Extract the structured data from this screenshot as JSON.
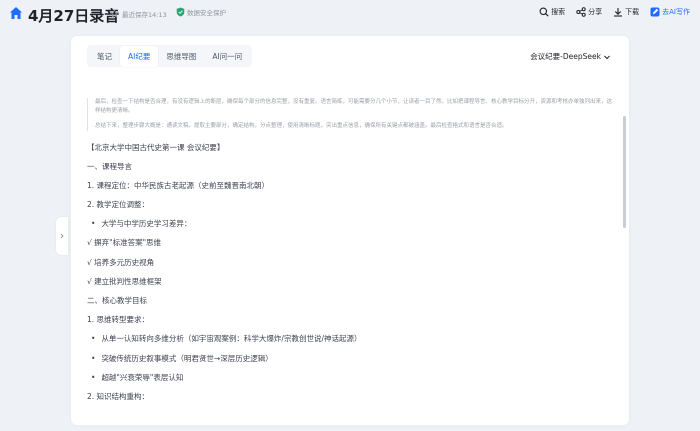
{
  "header": {
    "title": "4月27日录音",
    "saved_text": "最近保存14:13",
    "protect_text": "数据安全保护",
    "actions": {
      "search": "搜索",
      "share": "分享",
      "download": "下载",
      "ai_write": "去AI写作"
    }
  },
  "tabs": [
    "笔记",
    "AI纪要",
    "思维导图",
    "AI问一问"
  ],
  "model_select": "会议纪要-DeepSeek",
  "thinking": [
    "最后，检查一下结构是否合理，有没有逻辑上的断层，确保每个部分的信息完整，没有重复。语言简练，可能需要分几个小节，让读者一目了然。比如把课程导言、核心教学目标分开，资源和考核办单独列出来，这样结构更清晰。",
    "总结下来，整理步骤大概是：通读文稿，提取主要部分，确定结构，分点整理，使用清晰标题，突出重点信息，确保所有关键点都被涵盖。最后检查格式和语言是否合适。"
  ],
  "lines": [
    {
      "text": "【北京大学中国古代史第一课 会议纪要】",
      "type": "plain"
    },
    {
      "text": "一、课程导言",
      "type": "plain"
    },
    {
      "text": "1. 课程定位：中华民族古老起源（史前至魏晋南北朝）",
      "type": "plain"
    },
    {
      "text": "2. 教学定位调整：",
      "type": "plain"
    },
    {
      "text": "大学与中学历史学习差异：",
      "type": "bullet"
    },
    {
      "text": "√ 摒弃\"标准答案\"思维",
      "type": "plain"
    },
    {
      "text": "√ 培养多元历史视角",
      "type": "plain"
    },
    {
      "text": "√ 建立批判性思维框架",
      "type": "plain"
    },
    {
      "text": "二、核心教学目标",
      "type": "plain"
    },
    {
      "text": "1. 思维转型要求：",
      "type": "plain"
    },
    {
      "text": "从单一认知转向多维分析（如宇宙观案例：科学大爆炸/宗教创世说/神话起源）",
      "type": "bullet"
    },
    {
      "text": "突破传统历史叙事模式（明君贤世→深层历史逻辑）",
      "type": "bullet"
    },
    {
      "text": "超越\"兴衰荣辱\"表层认知",
      "type": "bullet"
    },
    {
      "text": "2. 知识结构重构：",
      "type": "plain"
    }
  ],
  "colors": {
    "accent": "#1f6bff",
    "protect_green": "#2ba471",
    "background": "#eef1f6"
  }
}
